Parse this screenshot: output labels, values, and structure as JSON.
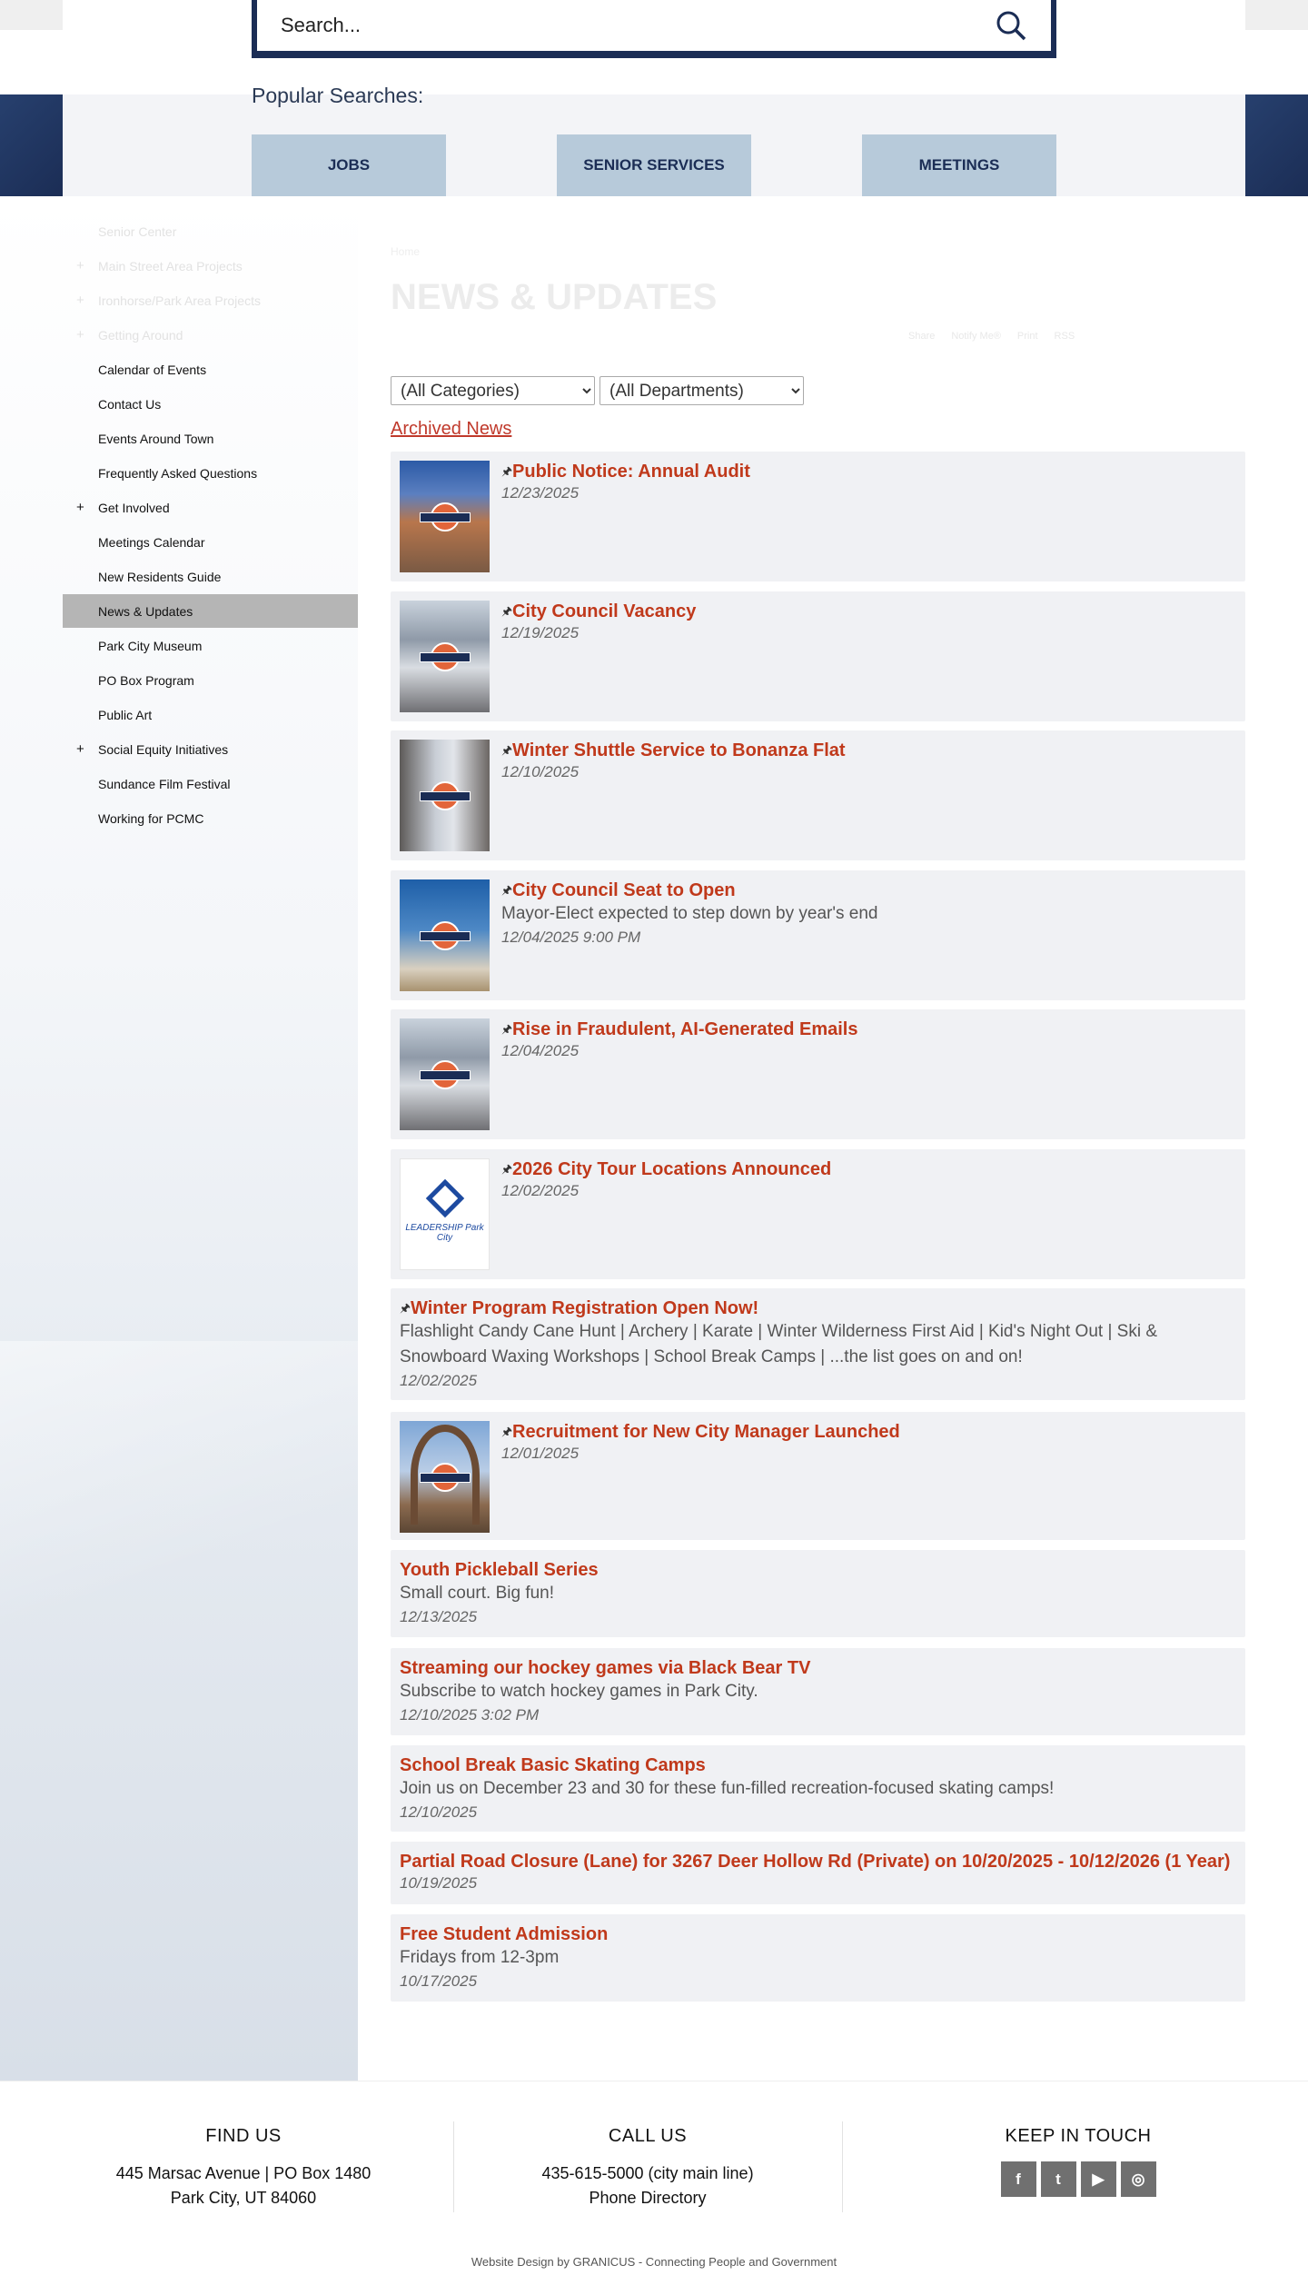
{
  "search": {
    "placeholder": "Search...",
    "popular_label": "Popular Searches:",
    "popular": [
      "JOBS",
      "SENIOR SERVICES",
      "MEETINGS"
    ]
  },
  "sidebar": {
    "items": [
      {
        "label": "Senior Center",
        "plus": false,
        "faded": true
      },
      {
        "label": "Main Street Area Projects",
        "plus": true,
        "faded": true
      },
      {
        "label": "Ironhorse/Park Area Projects",
        "plus": true,
        "faded": true
      },
      {
        "label": "Getting Around",
        "plus": true,
        "faded": true
      },
      {
        "label": "Calendar of Events",
        "plus": false
      },
      {
        "label": "Contact Us",
        "plus": false
      },
      {
        "label": "Events Around Town",
        "plus": false
      },
      {
        "label": "Frequently Asked Questions",
        "plus": false
      },
      {
        "label": "Get Involved",
        "plus": true
      },
      {
        "label": "Meetings Calendar",
        "plus": false
      },
      {
        "label": "New Residents Guide",
        "plus": false
      },
      {
        "label": "News & Updates",
        "plus": false,
        "active": true
      },
      {
        "label": "Park City Museum",
        "plus": false
      },
      {
        "label": "PO Box Program",
        "plus": false
      },
      {
        "label": "Public Art",
        "plus": false
      },
      {
        "label": "Social Equity Initiatives",
        "plus": true
      },
      {
        "label": "Sundance Film Festival",
        "plus": false
      },
      {
        "label": "Working for PCMC",
        "plus": false
      }
    ],
    "plus_symbol": "+"
  },
  "page": {
    "breadcrumb": "Home",
    "title": "NEWS & UPDATES",
    "tools": [
      "Share",
      "Notify Me®",
      "Print",
      "RSS"
    ],
    "category_select": "(All Categories)",
    "department_select": "(All Departments)",
    "archived": "Archived News",
    "pin": "🖈"
  },
  "news": [
    {
      "title": "Public Notice: Annual Audit",
      "date": "12/23/2025",
      "pinned": true,
      "thumb": "t1"
    },
    {
      "title": "City Council Vacancy",
      "date": "12/19/2025",
      "pinned": true,
      "thumb": "t2"
    },
    {
      "title": "Winter Shuttle Service to Bonanza Flat",
      "date": "12/10/2025",
      "pinned": true,
      "thumb": "t3"
    },
    {
      "title": "City Council Seat to Open",
      "subtitle": "Mayor-Elect expected to step down by year's end",
      "date": "12/04/2025 9:00 PM",
      "pinned": true,
      "thumb": "t4"
    },
    {
      "title": "Rise in Fraudulent, AI-Generated Emails",
      "date": "12/04/2025",
      "pinned": true,
      "thumb": "t2"
    },
    {
      "title": "2026 City Tour Locations Announced",
      "date": "12/02/2025",
      "pinned": true,
      "thumb": "t6",
      "thumb_text": "LEADERSHIP Park City"
    },
    {
      "title": "Winter Program Registration Open Now!",
      "subtitle": "Flashlight Candy Cane Hunt | Archery | Karate | Winter Wilderness First Aid | Kid's Night Out | Ski & Snowboard Waxing Workshops | School Break Camps | ...the list goes on and on!",
      "date": "12/02/2025",
      "pinned": true
    },
    {
      "title": "Recruitment for New City Manager Launched",
      "date": "12/01/2025",
      "pinned": true,
      "thumb": "t8"
    },
    {
      "title": "Youth Pickleball Series",
      "subtitle": "Small court. Big fun!",
      "date": "12/13/2025"
    },
    {
      "title": "Streaming our hockey games via Black Bear TV",
      "subtitle": "Subscribe to watch hockey games in Park City.",
      "date": "12/10/2025 3:02 PM"
    },
    {
      "title": "School Break Basic Skating Camps",
      "subtitle": "Join us on December 23 and 30 for these fun-filled recreation-focused skating camps!",
      "date": "12/10/2025"
    },
    {
      "title": "Partial Road Closure (Lane) for 3267 Deer Hollow Rd (Private) on 10/20/2025 - 10/12/2026 (1 Year)",
      "date": "10/19/2025"
    },
    {
      "title": "Free Student Admission",
      "subtitle": "Fridays from 12-3pm",
      "date": "10/17/2025"
    }
  ],
  "footer": {
    "find": {
      "heading": "FIND US",
      "line1": "445 Marsac Avenue | PO Box 1480",
      "line2": "Park City, UT 84060"
    },
    "call": {
      "heading": "CALL US",
      "line1": "435-615-5000 (city main line)",
      "line2": "Phone Directory"
    },
    "keep": {
      "heading": "KEEP IN TOUCH",
      "social": [
        "facebook",
        "twitter",
        "youtube",
        "instagram"
      ]
    },
    "credit": "Website Design by GRANICUS - Connecting People and Government"
  },
  "colors": {
    "navy": "#1b2d55",
    "link": "#c0391b",
    "button": "#b7cada"
  }
}
